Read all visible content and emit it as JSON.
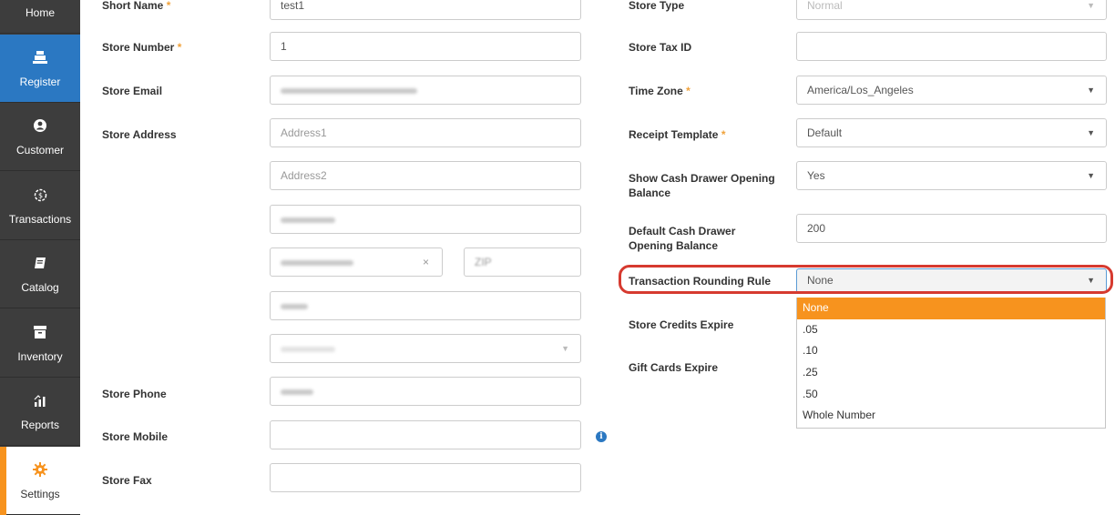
{
  "sidebar": {
    "items": [
      {
        "label": "Home",
        "icon": "home-icon"
      },
      {
        "label": "Register",
        "icon": "register-icon"
      },
      {
        "label": "Customer",
        "icon": "customer-icon"
      },
      {
        "label": "Transactions",
        "icon": "transactions-icon"
      },
      {
        "label": "Catalog",
        "icon": "catalog-icon"
      },
      {
        "label": "Inventory",
        "icon": "inventory-icon"
      },
      {
        "label": "Reports",
        "icon": "reports-icon"
      },
      {
        "label": "Settings",
        "icon": "gear-icon"
      }
    ],
    "colors": {
      "background": "#3d3d3d",
      "active_blue": "#2b78c2",
      "active_orange": "#f7931e"
    }
  },
  "left": {
    "short_name": {
      "label": "Short Name",
      "value": "test1"
    },
    "store_number": {
      "label": "Store Number",
      "value": "1"
    },
    "store_email": {
      "label": "Store Email"
    },
    "store_address": {
      "label": "Store Address",
      "address1_placeholder": "Address1",
      "address2_placeholder": "Address2",
      "zip_placeholder": "ZIP"
    },
    "store_phone": {
      "label": "Store Phone"
    },
    "store_mobile": {
      "label": "Store Mobile",
      "value": ""
    },
    "store_fax": {
      "label": "Store Fax",
      "value": ""
    },
    "required_mark": "*",
    "info_icon": "i"
  },
  "right": {
    "store_type": {
      "label": "Store Type",
      "value": "Normal"
    },
    "store_tax_id": {
      "label": "Store Tax ID",
      "value": ""
    },
    "time_zone": {
      "label": "Time Zone",
      "value": "America/Los_Angeles"
    },
    "receipt_template": {
      "label": "Receipt Template",
      "value": "Default"
    },
    "show_cash_drawer": {
      "label_line1": "Show Cash Drawer Opening",
      "label_line2": "Balance",
      "value": "Yes"
    },
    "default_cash_drawer": {
      "label_line1": "Default Cash Drawer",
      "label_line2": "Opening Balance",
      "value": "200"
    },
    "rounding_rule": {
      "label": "Transaction Rounding Rule",
      "value": "None",
      "options": [
        "None",
        ".05",
        ".10",
        ".25",
        ".50",
        "Whole Number"
      ]
    },
    "store_credits_expire": {
      "label": "Store Credits Expire"
    },
    "gift_cards_expire": {
      "label": "Gift Cards Expire"
    }
  },
  "caret": "▼",
  "clear_mark": "×",
  "highlight_color": "#d63a2f"
}
